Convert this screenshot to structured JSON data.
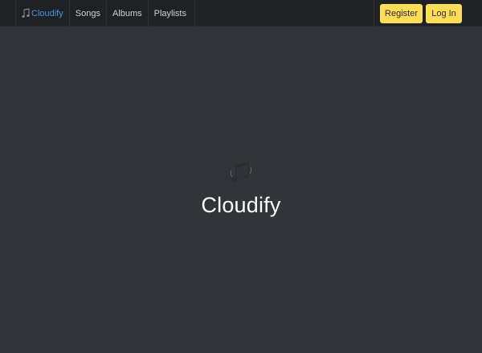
{
  "navbar": {
    "brand": "Cloudify",
    "brand_icon": "music-note-icon",
    "links": [
      "Songs",
      "Albums",
      "Playlists"
    ],
    "register_label": "Register",
    "login_label": "Log In"
  },
  "hero": {
    "icon": "music-notes-icon",
    "title": "Cloudify"
  },
  "colors": {
    "background": "#313439",
    "navbar": "#1f2125",
    "brand": "#4a90e2",
    "button": "#ffdd57"
  }
}
